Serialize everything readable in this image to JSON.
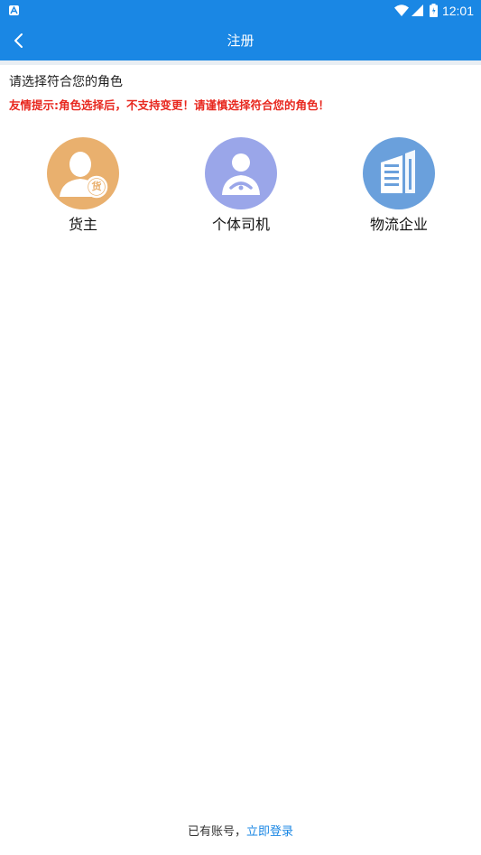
{
  "status_bar": {
    "time": "12:01",
    "icons": [
      "app-notification-icon",
      "wifi-icon",
      "cell-signal-icon",
      "battery-icon"
    ]
  },
  "app_bar": {
    "title": "注册",
    "back_icon": "chevron-left-icon"
  },
  "main": {
    "prompt": "请选择符合您的角色",
    "warning": "友情提示:角色选择后，不支持变更！请谨慎选择符合您的角色！",
    "roles": [
      {
        "label": "货主",
        "badge": "货",
        "icon": "cargo-owner-icon",
        "color": "#e9b06e"
      },
      {
        "label": "个体司机",
        "icon": "driver-icon",
        "color": "#9aa6e9"
      },
      {
        "label": "物流企业",
        "icon": "building-icon",
        "color": "#6aa0dc"
      }
    ]
  },
  "footer": {
    "prefix": "已有账号，",
    "link": "立即登录"
  },
  "colors": {
    "primary": "#1a87e4",
    "warning": "#e8281f"
  }
}
